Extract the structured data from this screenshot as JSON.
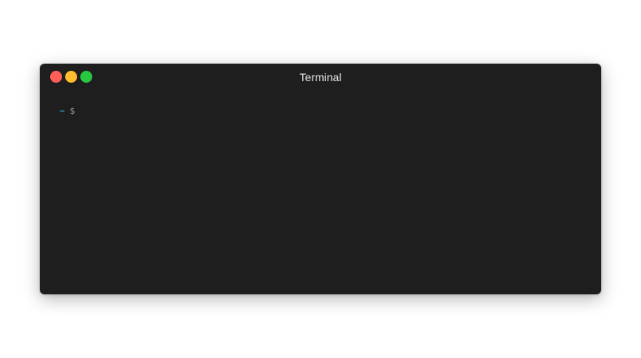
{
  "window": {
    "title": "Terminal",
    "background": "#1e1e1e",
    "controls": [
      {
        "name": "close",
        "color": "#ff5f57"
      },
      {
        "name": "minimize",
        "color": "#febc2e"
      },
      {
        "name": "maximize",
        "color": "#28c840"
      }
    ]
  },
  "terminal": {
    "prompt": {
      "directory": "~",
      "symbol": "$",
      "directory_color": "#3ab7d8",
      "symbol_color": "#9a9a9a"
    },
    "input": ""
  }
}
